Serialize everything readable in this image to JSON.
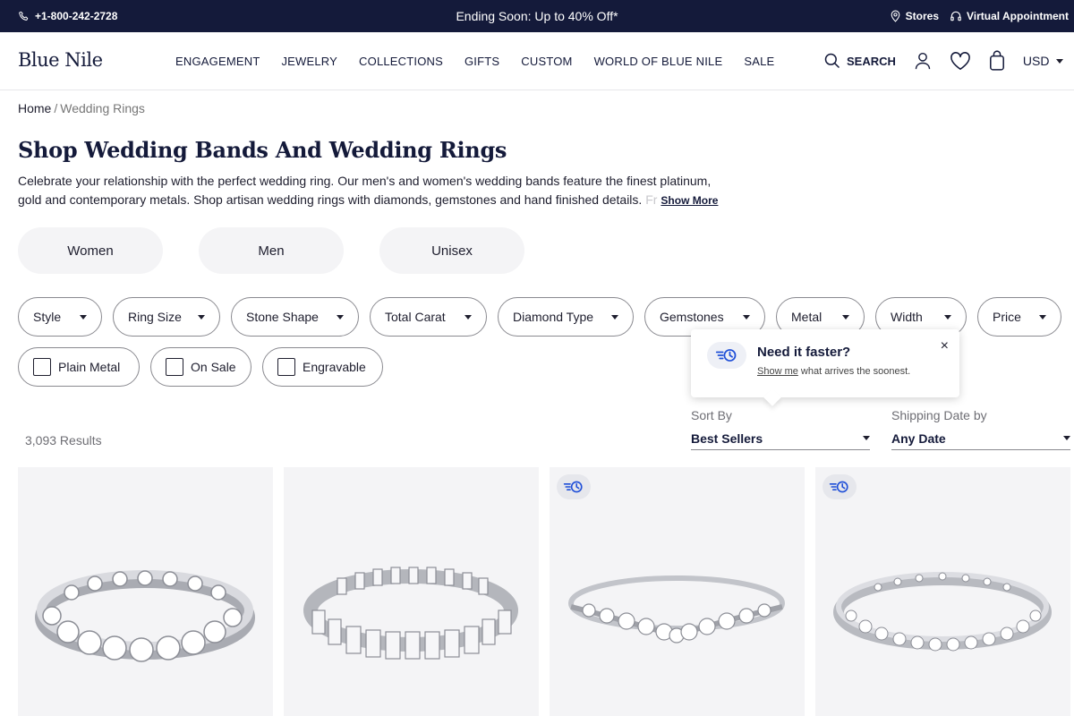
{
  "topbar": {
    "phone": "+1-800-242-2728",
    "promo": "Ending Soon: Up to 40% Off*",
    "stores": "Stores",
    "appointment": "Virtual Appointment"
  },
  "header": {
    "logo": "Blue Nile",
    "nav": [
      "ENGAGEMENT",
      "JEWELRY",
      "COLLECTIONS",
      "GIFTS",
      "CUSTOM",
      "WORLD OF BLUE NILE",
      "SALE"
    ],
    "search_label": "SEARCH",
    "currency": "USD"
  },
  "breadcrumb": {
    "home": "Home",
    "separator": "/",
    "current": "Wedding Rings"
  },
  "page": {
    "title": "Shop Wedding Bands And Wedding Rings",
    "desc_line1": "Celebrate your relationship with the perfect wedding ring. Our men's and women's wedding bands feature the finest platinum,",
    "desc_line2": "gold and contemporary metals. Shop artisan wedding rings with diamonds, gemstones and hand finished details.",
    "desc_fade": "Fr",
    "show_more": "Show More"
  },
  "gender": [
    "Women",
    "Men",
    "Unisex"
  ],
  "filters": [
    "Style",
    "Ring Size",
    "Stone Shape",
    "Total Carat",
    "Diamond Type",
    "Gemstones",
    "Metal",
    "Width",
    "Price"
  ],
  "checks": [
    "Plain Metal",
    "On Sale",
    "Engravable"
  ],
  "tooltip": {
    "title": "Need it faster?",
    "link": "Show me",
    "rest": " what arrives the soonest.",
    "close": "×"
  },
  "results": "3,093 Results",
  "sort": {
    "label": "Sort By",
    "value": "Best Sellers"
  },
  "shipping": {
    "label": "Shipping Date by",
    "value": "Any Date"
  },
  "colors": {
    "navy": "#141a3a",
    "badge_blue": "#1f4fd8",
    "card_bg": "#f4f4f6"
  },
  "products": [
    {
      "image": "round-eternity-band-image",
      "fast_ship_badge": false
    },
    {
      "image": "emerald-cut-eternity-band-image",
      "fast_ship_badge": false
    },
    {
      "image": "curved-diamond-band-image",
      "fast_ship_badge": true
    },
    {
      "image": "pave-eternity-band-image",
      "fast_ship_badge": true
    }
  ]
}
